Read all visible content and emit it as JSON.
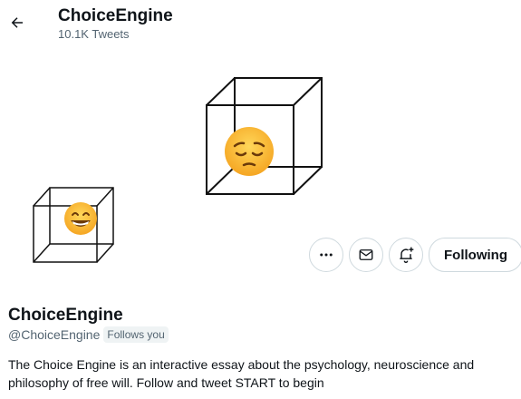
{
  "header": {
    "back_icon": "arrow-left-icon",
    "title": "ChoiceEngine",
    "subtitle": "10.1K Tweets"
  },
  "banner": {
    "cube_icon": "wireframe-cube",
    "face_emoji": "😔"
  },
  "avatar": {
    "cube_icon": "wireframe-cube",
    "face_emoji": "😁"
  },
  "actions": {
    "more_icon": "more-horizontal-icon",
    "message_icon": "envelope-icon",
    "notify_icon": "bell-plus-icon",
    "following_label": "Following"
  },
  "profile": {
    "name": "ChoiceEngine",
    "handle": "@ChoiceEngine",
    "follows_badge": "Follows you",
    "bio": "The Choice Engine is an interactive essay about the psychology, neuroscience and philosophy of free will. Follow and tweet START to begin"
  }
}
